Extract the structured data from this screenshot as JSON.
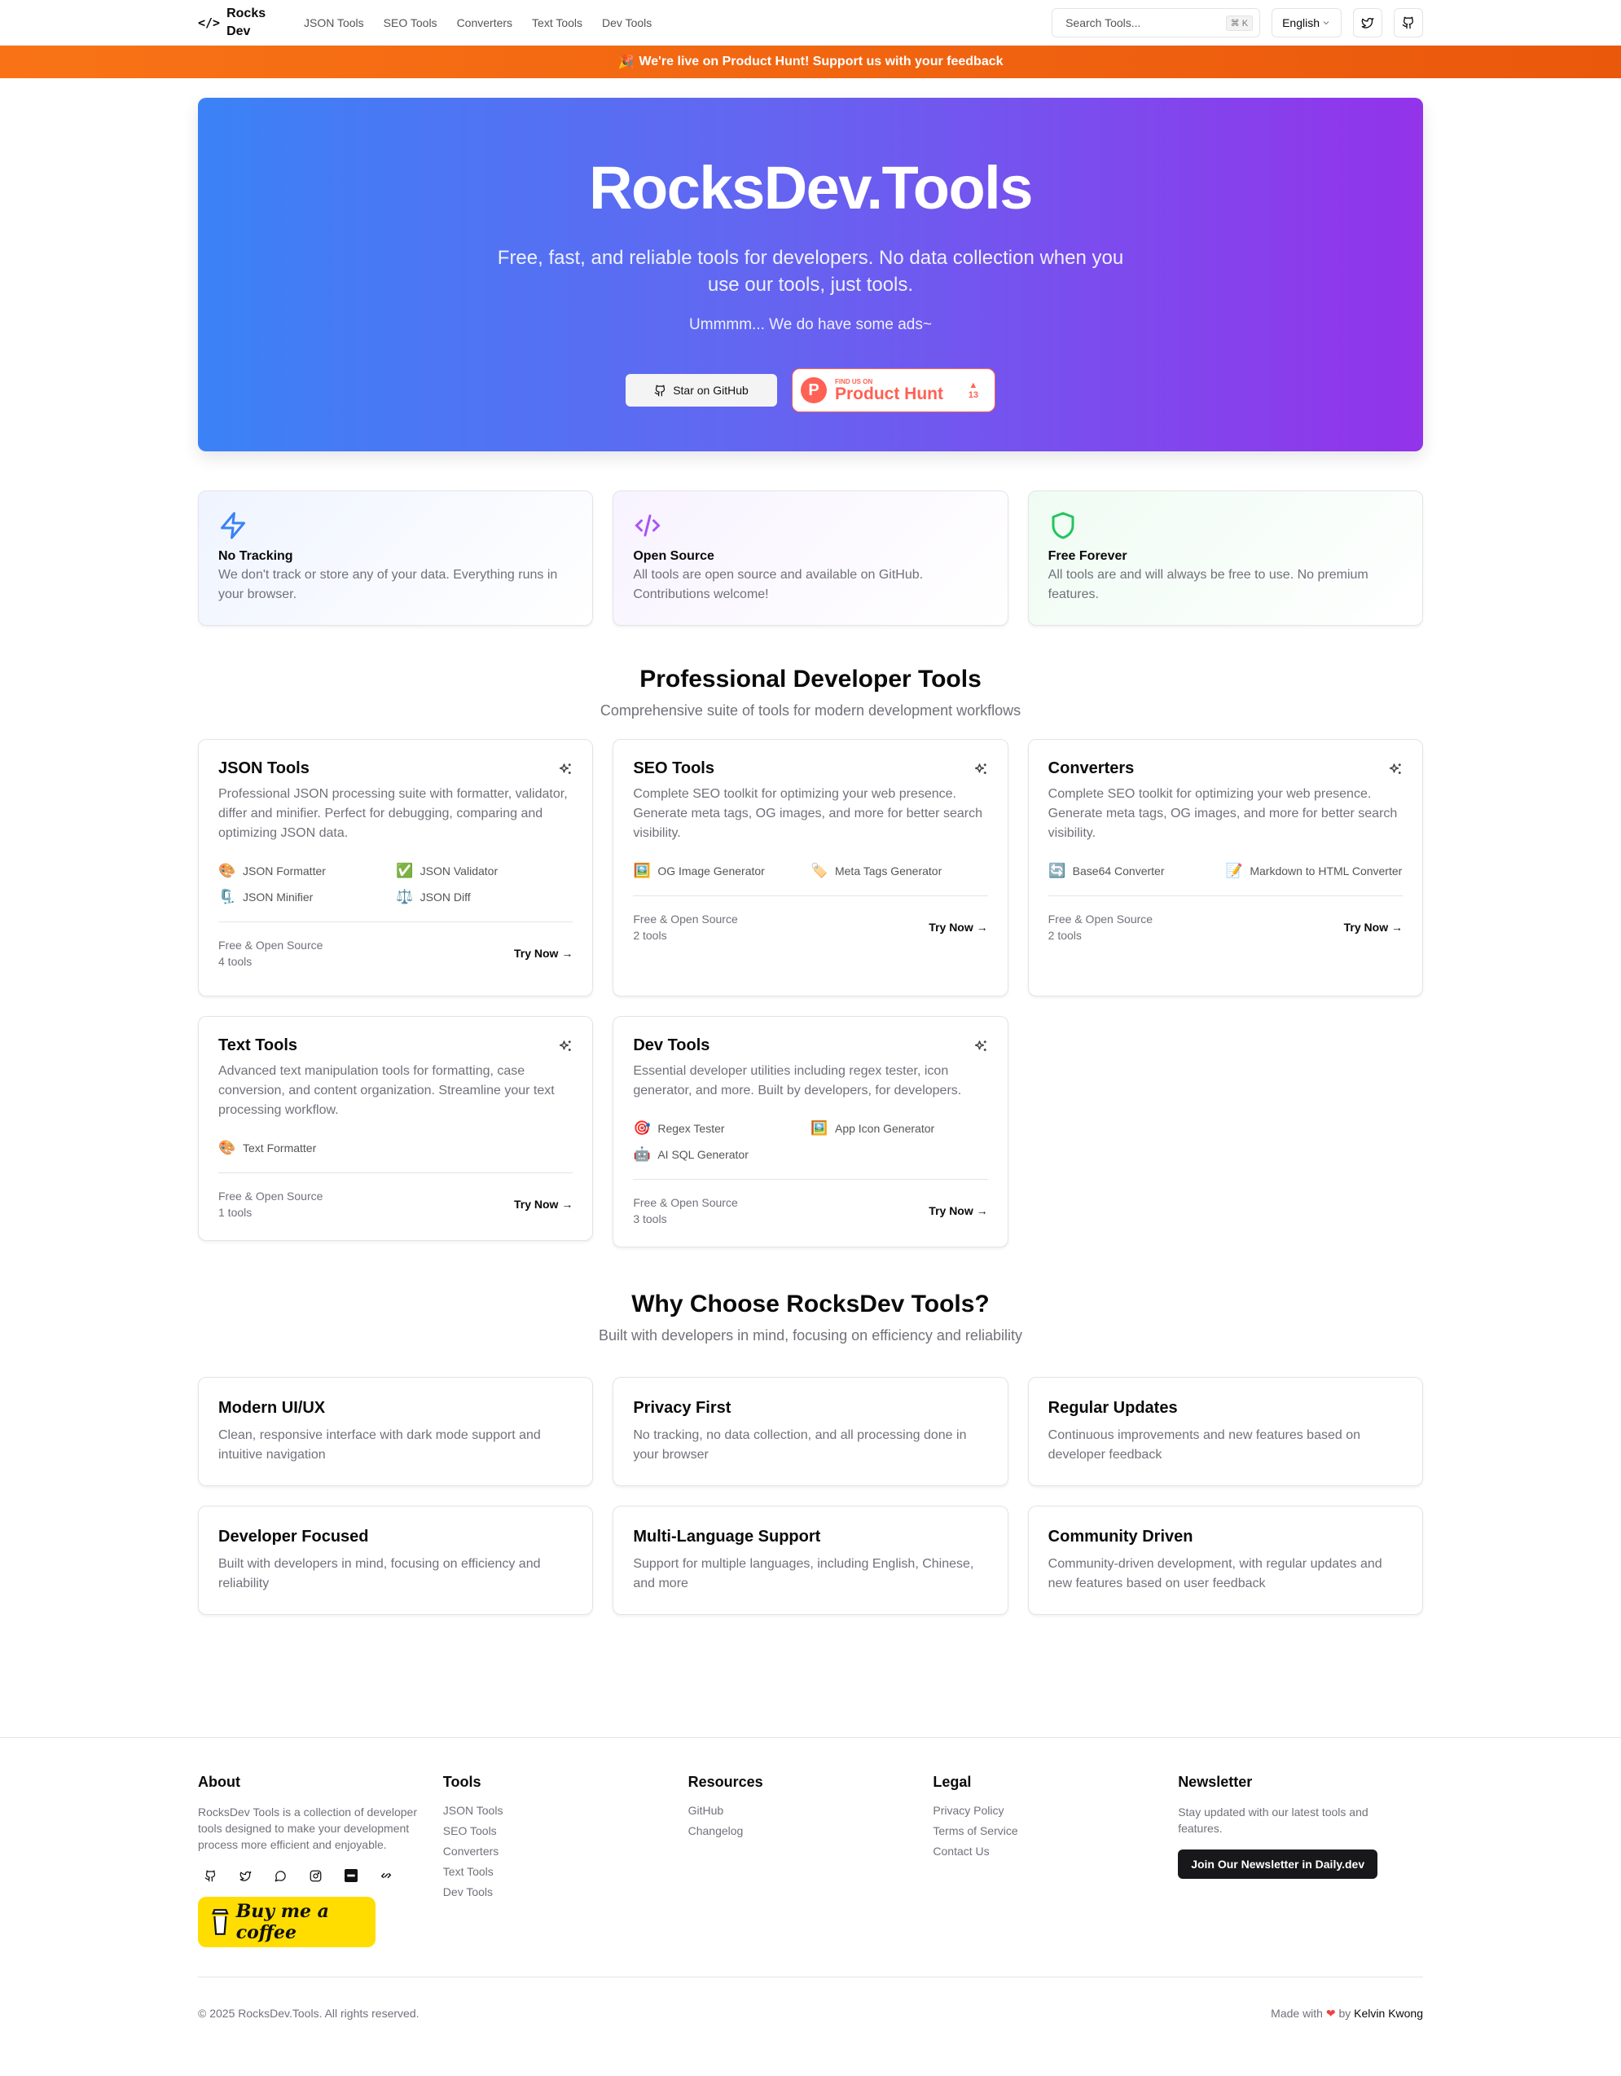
{
  "nav": {
    "logo_glyph": "</>",
    "logo_text": "Rocks Dev",
    "links": [
      "JSON Tools",
      "SEO Tools",
      "Converters",
      "Text Tools",
      "Dev Tools"
    ],
    "search_placeholder": "Search Tools...",
    "search_shortcut": "⌘ K",
    "language": "English"
  },
  "banner": {
    "emoji": "🎉",
    "text": "We're live on Product Hunt! Support us with your feedback"
  },
  "hero": {
    "title": "RocksDev.Tools",
    "subtitle": "Free, fast, and reliable tools for developers. No data collection when you use our tools, just tools.",
    "note": "Ummmm... We do have some ads~",
    "github_button": "Star on GitHub",
    "ph_small": "FIND US ON",
    "ph_big": "Product Hunt",
    "ph_votes": "13"
  },
  "features": [
    {
      "icon": "lightning-icon",
      "title": "No Tracking",
      "desc": "We don't track or store any of your data. Everything runs in your browser."
    },
    {
      "icon": "code-icon",
      "title": "Open Source",
      "desc": "All tools are open source and available on GitHub. Contributions welcome!"
    },
    {
      "icon": "shield-icon",
      "title": "Free Forever",
      "desc": "All tools are and will always be free to use. No premium features."
    }
  ],
  "tools_section": {
    "title": "Professional Developer Tools",
    "subtitle": "Comprehensive suite of tools for modern development workflows",
    "meta_label": "Free & Open Source",
    "try_label": "Try Now →",
    "cards": [
      {
        "title": "JSON Tools",
        "desc": "Professional JSON processing suite with formatter, validator, differ and minifier. Perfect for debugging, comparing and optimizing JSON data.",
        "count": "4 tools",
        "items": [
          {
            "emoji": "🎨",
            "label": "JSON Formatter"
          },
          {
            "emoji": "✅",
            "label": "JSON Validator"
          },
          {
            "emoji": "🗜️",
            "label": "JSON Minifier"
          },
          {
            "emoji": "⚖️",
            "label": "JSON Diff"
          }
        ]
      },
      {
        "title": "SEO Tools",
        "desc": "Complete SEO toolkit for optimizing your web presence. Generate meta tags, OG images, and more for better search visibility.",
        "count": "2 tools",
        "items": [
          {
            "emoji": "🖼️",
            "label": "OG Image Generator"
          },
          {
            "emoji": "🏷️",
            "label": "Meta Tags Generator"
          }
        ]
      },
      {
        "title": "Converters",
        "desc": "Complete SEO toolkit for optimizing your web presence. Generate meta tags, OG images, and more for better search visibility.",
        "count": "2 tools",
        "items": [
          {
            "emoji": "🔄",
            "label": "Base64 Converter"
          },
          {
            "emoji": "📝",
            "label": "Markdown to HTML Converter"
          }
        ]
      },
      {
        "title": "Text Tools",
        "desc": "Advanced text manipulation tools for formatting, case conversion, and content organization. Streamline your text processing workflow.",
        "count": "1 tools",
        "items": [
          {
            "emoji": "🎨",
            "label": "Text Formatter"
          }
        ]
      },
      {
        "title": "Dev Tools",
        "desc": "Essential developer utilities including regex tester, icon generator, and more. Built by developers, for developers.",
        "count": "3 tools",
        "items": [
          {
            "emoji": "🎯",
            "label": "Regex Tester"
          },
          {
            "emoji": "🖼️",
            "label": "App Icon Generator"
          },
          {
            "emoji": "🤖",
            "label": "AI SQL Generator"
          }
        ]
      }
    ]
  },
  "why_section": {
    "title": "Why Choose RocksDev Tools?",
    "subtitle": "Built with developers in mind, focusing on efficiency and reliability",
    "cards": [
      {
        "title": "Modern UI/UX",
        "desc": "Clean, responsive interface with dark mode support and intuitive navigation"
      },
      {
        "title": "Privacy First",
        "desc": "No tracking, no data collection, and all processing done in your browser"
      },
      {
        "title": "Regular Updates",
        "desc": "Continuous improvements and new features based on developer feedback"
      },
      {
        "title": "Developer Focused",
        "desc": "Built with developers in mind, focusing on efficiency and reliability"
      },
      {
        "title": "Multi-Language Support",
        "desc": "Support for multiple languages, including English, Chinese, and more"
      },
      {
        "title": "Community Driven",
        "desc": "Community-driven development, with regular updates and new features based on user feedback"
      }
    ]
  },
  "footer": {
    "about": {
      "title": "About",
      "text": "RocksDev Tools is a collection of developer tools designed to make your development process more efficient and enjoyable."
    },
    "tools": {
      "title": "Tools",
      "links": [
        "JSON Tools",
        "SEO Tools",
        "Converters",
        "Text Tools",
        "Dev Tools"
      ]
    },
    "resources": {
      "title": "Resources",
      "links": [
        "GitHub",
        "Changelog"
      ]
    },
    "legal": {
      "title": "Legal",
      "links": [
        "Privacy Policy",
        "Terms of Service",
        "Contact Us"
      ]
    },
    "newsletter": {
      "title": "Newsletter",
      "text": "Stay updated with our latest tools and features.",
      "button": "Join Our Newsletter in Daily.dev"
    },
    "bmc_label": "Buy me a coffee",
    "copyright": "© 2025 RocksDev.Tools. All rights reserved.",
    "made_with": "Made with",
    "made_by": "by",
    "author": "Kelvin Kwong"
  },
  "colors": {
    "banner": "#f97316",
    "hero_start": "#3b82f6",
    "hero_end": "#9333ea",
    "product_hunt": "#ff6154",
    "bmc_yellow": "#ffdd00"
  }
}
